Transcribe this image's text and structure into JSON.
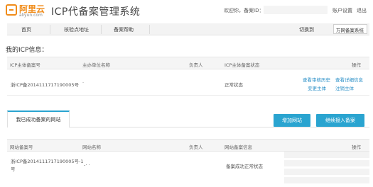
{
  "header": {
    "logo_text": "阿里云",
    "logo_sub": "aliyun.com",
    "system_title": "ICP代备案管理系统",
    "welcome": "欢迎你，备案ID：",
    "account_settings": "账户设置",
    "logout": "退出"
  },
  "nav": {
    "items": [
      "首页",
      "核验点地址",
      "备案帮助"
    ],
    "switch_label": "切换到",
    "switch_value": "万网备案系统"
  },
  "icp_info": {
    "title": "我的ICP信息：",
    "columns": [
      "ICP主体备案号",
      "主办单位名称",
      "负责人",
      "ICP主体备案状态",
      "操作"
    ],
    "rows": [
      {
        "record_no": "浙ICP备2014111717190005号",
        "org_name": "·",
        "owner": "",
        "status": "正常状态",
        "actions": [
          "查看审核历史",
          "查看详细信息",
          "变更主体",
          "注销主体"
        ]
      }
    ]
  },
  "sites": {
    "tab_label": "我已成功备案的网站",
    "add_site_button": "增加网站",
    "continue_button": "继续接入备案",
    "columns": [
      "网站备案号",
      "网站名称",
      "负责人",
      "网站备案信息",
      "操作"
    ],
    "rows": [
      {
        "record_no_line1": "浙ICP备2014111717190005号-1",
        "record_no_line2": "号",
        "site_name": "-· ·",
        "owner": "",
        "info": "备案成功正常状态",
        "actions": []
      }
    ]
  }
}
